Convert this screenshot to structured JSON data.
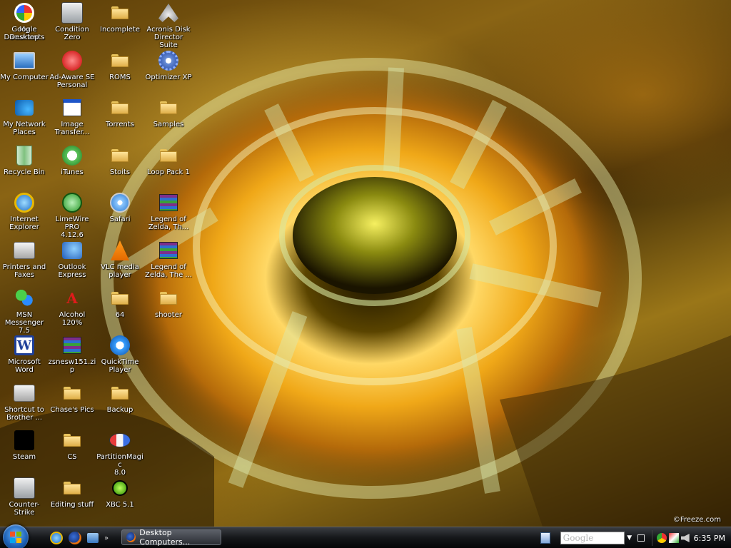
{
  "desktop": {
    "icons": [
      {
        "id": "my-documents",
        "label": "My Documents",
        "type": "mydocs"
      },
      {
        "id": "my-computer",
        "label": "My Computer",
        "type": "computer"
      },
      {
        "id": "my-network-places",
        "label": "My Network\nPlaces",
        "type": "network"
      },
      {
        "id": "recycle-bin",
        "label": "Recycle Bin",
        "type": "recycle"
      },
      {
        "id": "internet-explorer",
        "label": "Internet\nExplorer",
        "type": "ie"
      },
      {
        "id": "printers-and-faxes",
        "label": "Printers and\nFaxes",
        "type": "printer"
      },
      {
        "id": "msn-messenger",
        "label": "MSN\nMessenger 7.5",
        "type": "msn"
      },
      {
        "id": "microsoft-word",
        "label": "Microsoft\nWord",
        "type": "word"
      },
      {
        "id": "shortcut-to-brother",
        "label": "Shortcut to\nBrother ...",
        "type": "printer"
      },
      {
        "id": "steam",
        "label": "Steam",
        "type": "steam"
      },
      {
        "id": "counter-strike",
        "label": "Counter-Strike",
        "type": "cs"
      },
      {
        "id": "condition-zero",
        "label": "Condition Zero",
        "type": "cs"
      },
      {
        "id": "ad-aware",
        "label": "Ad-Aware SE\nPersonal",
        "type": "adaware"
      },
      {
        "id": "image-transfer",
        "label": "Image\nTransfer...",
        "type": "window"
      },
      {
        "id": "itunes",
        "label": "iTunes",
        "type": "itunes"
      },
      {
        "id": "limewire",
        "label": "LimeWire PRO\n4.12.6",
        "type": "limewire"
      },
      {
        "id": "outlook-express",
        "label": "Outlook\nExpress",
        "type": "outlook"
      },
      {
        "id": "alcohol",
        "label": "Alcohol 120%",
        "type": "alcohol"
      },
      {
        "id": "zsnesw151",
        "label": "zsnesw151.zip",
        "type": "zip"
      },
      {
        "id": "chases-pics",
        "label": "Chase's Pics",
        "type": "folder"
      },
      {
        "id": "cs-folder",
        "label": "CS",
        "type": "folder"
      },
      {
        "id": "editing-stuff",
        "label": "Editing stuff",
        "type": "folder"
      },
      {
        "id": "incomplete",
        "label": "Incomplete",
        "type": "folder"
      },
      {
        "id": "roms",
        "label": "ROMS",
        "type": "folder"
      },
      {
        "id": "torrents",
        "label": "Torrents",
        "type": "folder"
      },
      {
        "id": "stoits",
        "label": "Stoits",
        "type": "folder"
      },
      {
        "id": "safari",
        "label": "Safari",
        "type": "safari"
      },
      {
        "id": "vlc",
        "label": "VLC media\nplayer",
        "type": "vlc"
      },
      {
        "id": "folder-64",
        "label": "64",
        "type": "folder"
      },
      {
        "id": "quicktime",
        "label": "QuickTime\nPlayer",
        "type": "quicktime"
      },
      {
        "id": "backup",
        "label": "Backup",
        "type": "folder"
      },
      {
        "id": "partitionmagic",
        "label": "PartitionMagic\n8.0",
        "type": "partition"
      },
      {
        "id": "xbc",
        "label": "XBC 5.1",
        "type": "xbc"
      },
      {
        "id": "acronis",
        "label": "Acronis Disk\nDirector Suite",
        "type": "acronis"
      },
      {
        "id": "optimizer-xp",
        "label": "Optimizer XP",
        "type": "gear"
      },
      {
        "id": "samples",
        "label": "Samples",
        "type": "folder"
      },
      {
        "id": "loop-pack-1",
        "label": "Loop Pack 1",
        "type": "folder"
      },
      {
        "id": "legend-of-zelda-1",
        "label": "Legend of\nZelda, Th...",
        "type": "zip"
      },
      {
        "id": "legend-of-zelda-2",
        "label": "Legend of\nZelda, The ...",
        "type": "zip"
      },
      {
        "id": "shooter",
        "label": "shooter",
        "type": "folder"
      },
      {
        "id": "google-desktop",
        "label": "Google\nDesktop",
        "type": "google"
      }
    ],
    "watermark": "©Freeze.com"
  },
  "taskbar": {
    "quick_launch_more": "»",
    "task_button_label": "Desktop Computers...",
    "search_placeholder": "Google",
    "search_dropdown": "▼",
    "clock": "6:35 PM"
  },
  "colors": {
    "taskbar": "#15171a",
    "folder": "#f5cf6c",
    "accent_blue": "#1d62b8"
  }
}
